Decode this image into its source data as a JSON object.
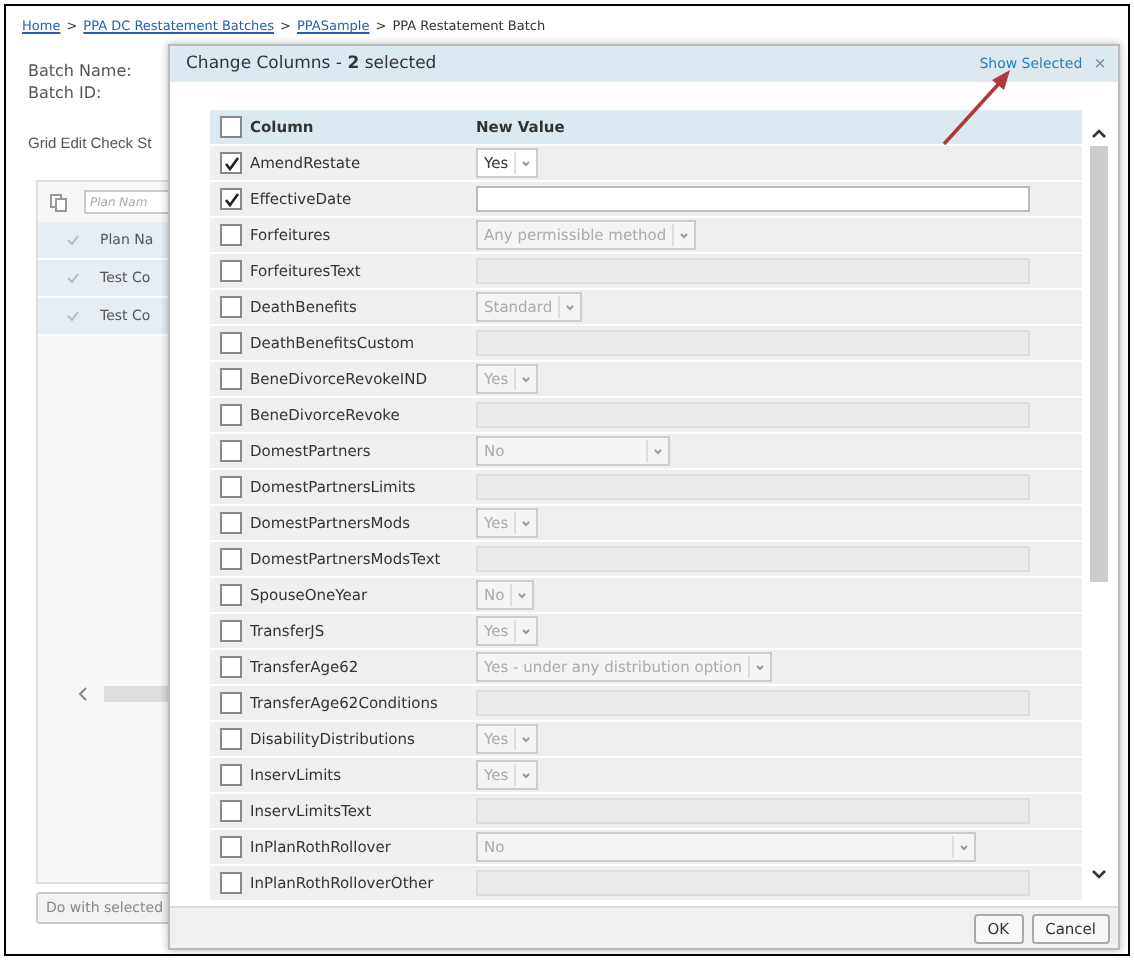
{
  "breadcrumb": {
    "separator": ">",
    "items": [
      {
        "label": "Home",
        "link": true
      },
      {
        "label": "PPA DC Restatement Batches",
        "link": true
      },
      {
        "label": "PPASample",
        "link": true
      },
      {
        "label": "PPA Restatement Batch",
        "link": false
      }
    ]
  },
  "fields": [
    "Batch Name:",
    "Batch ID:"
  ],
  "grid_heading": "Grid Edit Check St",
  "grid": {
    "filter_placeholder": "Plan Nam",
    "header": "Plan Na",
    "rows": [
      "Test Co",
      "Test Co"
    ],
    "action_button": "Do with selected"
  },
  "dialog": {
    "title": "Change Columns - **2** selected",
    "show_selected": "Show Selected",
    "close": "×",
    "all_checked": false,
    "columns": [
      "Column",
      "New Value"
    ],
    "rows": [
      {
        "name": "AmendRestate",
        "checked": true,
        "kind": "select",
        "value": "Yes"
      },
      {
        "name": "EffectiveDate",
        "checked": true,
        "kind": "text"
      },
      {
        "name": "Forfeitures",
        "checked": false,
        "kind": "select",
        "value": "Any permissible method"
      },
      {
        "name": "ForfeituresText",
        "checked": false,
        "kind": "text"
      },
      {
        "name": "DeathBenefits",
        "checked": false,
        "kind": "select",
        "value": "Standard"
      },
      {
        "name": "DeathBenefitsCustom",
        "checked": false,
        "kind": "text"
      },
      {
        "name": "BeneDivorceRevokeIND",
        "checked": false,
        "kind": "select",
        "value": "Yes"
      },
      {
        "name": "BeneDivorceRevoke",
        "checked": false,
        "kind": "text"
      },
      {
        "name": "DomestPartners",
        "checked": false,
        "kind": "wideselect",
        "value": "No"
      },
      {
        "name": "DomestPartnersLimits",
        "checked": false,
        "kind": "text"
      },
      {
        "name": "DomestPartnersMods",
        "checked": false,
        "kind": "select",
        "value": "Yes"
      },
      {
        "name": "DomestPartnersModsText",
        "checked": false,
        "kind": "text"
      },
      {
        "name": "SpouseOneYear",
        "checked": false,
        "kind": "select",
        "value": "No"
      },
      {
        "name": "TransferJS",
        "checked": false,
        "kind": "select",
        "value": "Yes"
      },
      {
        "name": "TransferAge62",
        "checked": false,
        "kind": "select",
        "value": "Yes - under any distribution option"
      },
      {
        "name": "TransferAge62Conditions",
        "checked": false,
        "kind": "text"
      },
      {
        "name": "DisabilityDistributions",
        "checked": false,
        "kind": "select",
        "value": "Yes"
      },
      {
        "name": "InservLimits",
        "checked": false,
        "kind": "select",
        "value": "Yes"
      },
      {
        "name": "InservLimitsText",
        "checked": false,
        "kind": "text"
      },
      {
        "name": "InPlanRothRollover",
        "checked": false,
        "kind": "longselect",
        "value": "No"
      },
      {
        "name": "InPlanRothRolloverOther",
        "checked": false,
        "kind": "text"
      }
    ],
    "buttons": [
      "OK",
      "Cancel"
    ]
  }
}
